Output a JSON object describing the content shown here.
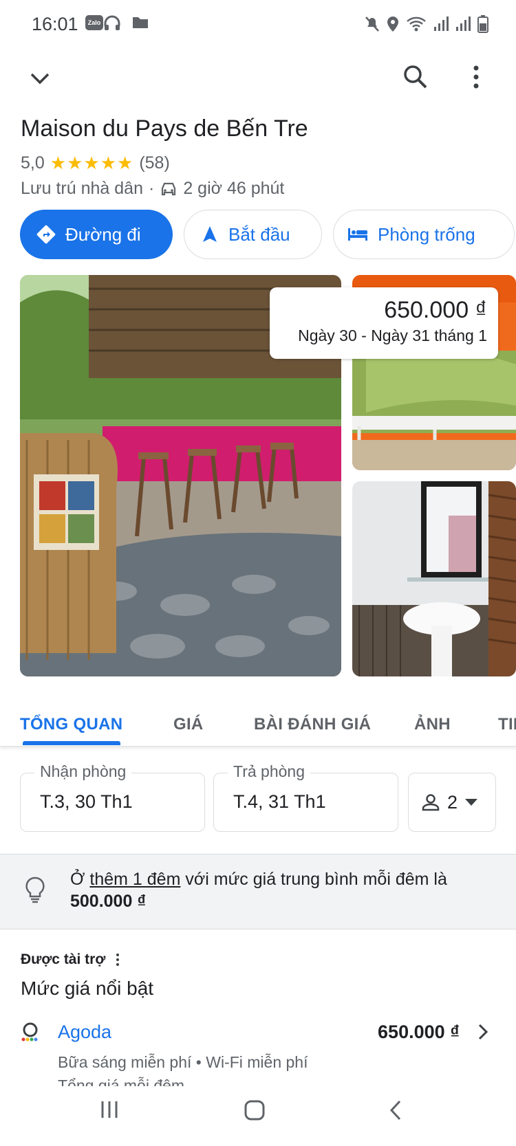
{
  "status_bar": {
    "time": "16:01",
    "left_icons": [
      "zalo-icon",
      "headphones-icon",
      "folder-icon"
    ],
    "zalo_label": "Zalo",
    "right_icons": [
      "mute-icon",
      "location-icon",
      "wifi-icon",
      "signal-icon",
      "signal-icon",
      "battery-icon"
    ]
  },
  "top_bar": {
    "icons": [
      "chevron-down-icon",
      "search-icon",
      "more-vert-icon"
    ]
  },
  "place": {
    "name": "Maison du Pays de Bến Tre",
    "rating": "5,0",
    "stars": "★★★★★",
    "review_count": "(58)",
    "category": "Lưu trú nhà dân",
    "separator": "·",
    "drive_time": "2 giờ 46 phút"
  },
  "actions": {
    "directions": "Đường đi",
    "start": "Bắt đầu",
    "rooms": "Phòng trống"
  },
  "price_card": {
    "price": "650.000 ₫",
    "dates": "Ngày 30 - Ngày 31 tháng 1"
  },
  "tabs": [
    "TỔNG QUAN",
    "GIÁ",
    "BÀI ĐÁNH GIÁ",
    "ẢNH",
    "TIN"
  ],
  "booking": {
    "checkin_label": "Nhận phòng",
    "checkin_value": "T.3, 30 Th1",
    "checkout_label": "Trả phòng",
    "checkout_value": "T.4, 31 Th1",
    "guests": "2"
  },
  "tip": {
    "prefix": "Ở ",
    "link": "thêm 1 đêm",
    "middle": " với mức giá trung bình mỗi đêm là ",
    "price": "500.000 ₫"
  },
  "sponsored": {
    "label": "Được tài trợ",
    "title": "Mức giá nổi bật"
  },
  "offer": {
    "provider": "Agoda",
    "price": "650.000 ₫",
    "amenities": "Bữa sáng miễn phí  •  Wi-Fi miễn phí",
    "nightly": "Tổng giá mỗi đêm"
  },
  "colors": {
    "accent": "#1a73e8",
    "star": "#fbbc04",
    "text_secondary": "#5f6368",
    "tip_background": "#f1f3f4"
  }
}
